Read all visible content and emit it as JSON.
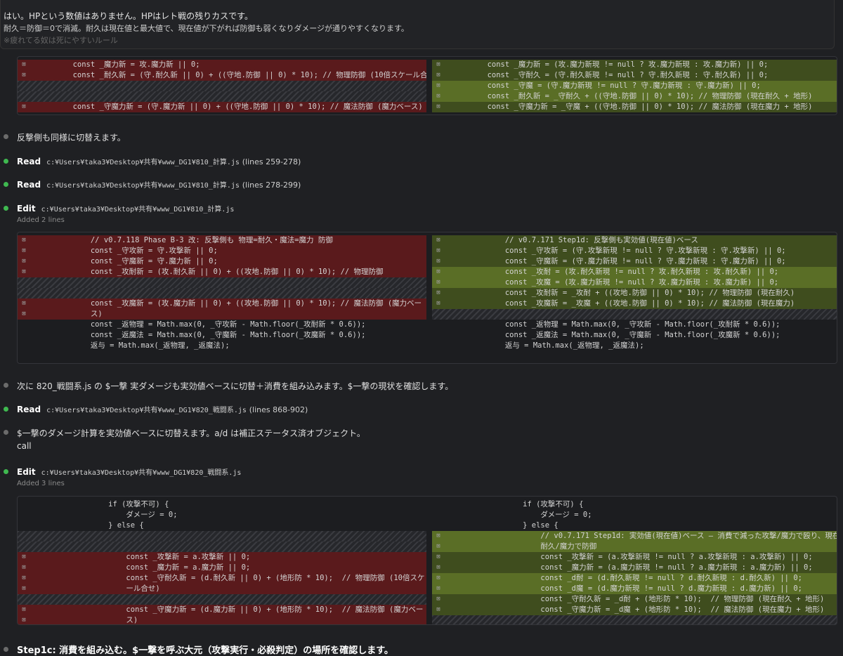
{
  "quote": {
    "line1": "はい。HPという数値はありません。HPはレト戦の残りカスです。",
    "line2": "耐久＝防御＝0で消滅。耐久は現在値と最大値で、現在値が下がれば防御も弱くなりダメージが通りやすくなります。",
    "line3": "※疲れてる奴は死にやすいルール"
  },
  "diff1": {
    "left": [
      {
        "g": "⊠",
        "t": "        const _魔力新 = 攻.魔力新 || 0;",
        "k": "del"
      },
      {
        "g": "⊠",
        "t": "        const _耐久新 = (守.耐久新 || 0) + ((守地.防御 || 0) * 10); // 物理防御 (10倍スケール合せ)",
        "k": "del"
      },
      {
        "g": "",
        "t": "",
        "k": "hatch"
      },
      {
        "g": "",
        "t": "",
        "k": "hatch"
      },
      {
        "g": "⊠",
        "t": "        const _守魔力新 = (守.魔力新 || 0) + ((守地.防御 || 0) * 10); // 魔法防御 (魔力ベース)",
        "k": "del"
      }
    ],
    "right": [
      {
        "g": "⊠",
        "t": "        const _魔力新 = (攻.魔力新現 != null ? 攻.魔力新現 : 攻.魔力新) || 0;",
        "k": "add"
      },
      {
        "g": "⊠",
        "t": "        const _守耐久 = (守.耐久新現 != null ? 守.耐久新現 : 守.耐久新) || 0;",
        "k": "add"
      },
      {
        "g": "⊠",
        "t": "        const _守魔 = (守.魔力新現 != null ? 守.魔力新現 : 守.魔力新) || 0;",
        "k": "addhi"
      },
      {
        "g": "⊠",
        "t": "        const _耐久新 = _守耐久 + ((守地.防御 || 0) * 10); // 物理防御 (現在耐久 + 地形)",
        "k": "addhi"
      },
      {
        "g": "⊠",
        "t": "        const _守魔力新 = _守魔 + ((守地.防御 || 0) * 10); // 魔法防御 (現在魔力 + 地形)",
        "k": "add"
      }
    ]
  },
  "items": {
    "m1": "反撃側も同様に切替えます。",
    "read1": {
      "label": "Read",
      "path": "c:¥Users¥taka3¥Desktop¥共有¥www_DG1¥810_計算.js",
      "range": "(lines 259-278)"
    },
    "read2": {
      "label": "Read",
      "path": "c:¥Users¥taka3¥Desktop¥共有¥www_DG1¥810_計算.js",
      "range": "(lines 278-299)"
    },
    "edit1": {
      "label": "Edit",
      "path": "c:¥Users¥taka3¥Desktop¥共有¥www_DG1¥810_計算.js",
      "sub": "Added 2 lines"
    },
    "m2": "次に 820_戦闘系.js の $一撃 実ダメージも実効値ベースに切替＋消費を組み込みます。$一撃の現状を確認します。",
    "read3": {
      "label": "Read",
      "path": "c:¥Users¥taka3¥Desktop¥共有¥www_DG1¥820_戦闘系.js",
      "range": "(lines 868-902)"
    },
    "m3": "$一撃のダメージ計算を実効値ベースに切替えます。a/d は補正ステータス済オブジェクト。",
    "m3b": "call",
    "edit2": {
      "label": "Edit",
      "path": "c:¥Users¥taka3¥Desktop¥共有¥www_DG1¥820_戦闘系.js",
      "sub": "Added 3 lines"
    },
    "m4": "Step1c: 消費を組み込む。$一撃を呼ぶ大元（攻撃実行・必殺判定）の場所を確認します。"
  },
  "diff2": {
    "left": [
      {
        "g": "⊠",
        "t": "            // v0.7.118 Phase B-3 改: 反撃側も 物理=耐久・魔法=魔力 防御",
        "k": "del"
      },
      {
        "g": "⊠",
        "t": "            const _守攻新 = 守.攻撃新 || 0;",
        "k": "del"
      },
      {
        "g": "⊠",
        "t": "            const _守魔新 = 守.魔力新 || 0;",
        "k": "del"
      },
      {
        "g": "⊠",
        "t": "            const _攻耐新 = (攻.耐久新 || 0) + ((攻地.防御 || 0) * 10); // 物理防御",
        "k": "del"
      },
      {
        "g": "",
        "t": "",
        "k": "hatch"
      },
      {
        "g": "",
        "t": "",
        "k": "hatch"
      },
      {
        "g": "⊠",
        "t": "            const _攻魔新 = (攻.魔力新 || 0) + ((攻地.防御 || 0) * 10); // 魔法防御 (魔力ベー",
        "k": "del"
      },
      {
        "g": "⊠",
        "t": "            ス)",
        "k": "del"
      },
      {
        "g": "",
        "t": "            const _返物理 = Math.max(0, _守攻新 - Math.floor(_攻耐新 * 0.6));",
        "k": ""
      },
      {
        "g": "",
        "t": "            const _返魔法 = Math.max(0, _守魔新 - Math.floor(_攻魔新 * 0.6));",
        "k": ""
      },
      {
        "g": "",
        "t": "            返与 = Math.max(_返物理, _返魔法);",
        "k": ""
      }
    ],
    "right": [
      {
        "g": "⊠",
        "t": "            // v0.7.171 Step1d: 反撃側も実効値(現在値)ベース",
        "k": "add"
      },
      {
        "g": "⊠",
        "t": "            const _守攻新 = (守.攻撃新現 != null ? 守.攻撃新現 : 守.攻撃新) || 0;",
        "k": "add"
      },
      {
        "g": "⊠",
        "t": "            const _守魔新 = (守.魔力新現 != null ? 守.魔力新現 : 守.魔力新) || 0;",
        "k": "add"
      },
      {
        "g": "⊠",
        "t": "            const _攻耐 = (攻.耐久新現 != null ? 攻.耐久新現 : 攻.耐久新) || 0;",
        "k": "addhi"
      },
      {
        "g": "⊠",
        "t": "            const _攻魔 = (攻.魔力新現 != null ? 攻.魔力新現 : 攻.魔力新) || 0;",
        "k": "addhi"
      },
      {
        "g": "⊠",
        "t": "            const _攻耐新 = _攻耐 + ((攻地.防御 || 0) * 10); // 物理防御 (現在耐久)",
        "k": "add"
      },
      {
        "g": "⊠",
        "t": "            const _攻魔新 = _攻魔 + ((攻地.防御 || 0) * 10); // 魔法防御 (現在魔力)",
        "k": "add"
      },
      {
        "g": "",
        "t": "",
        "k": "hatch"
      },
      {
        "g": "",
        "t": "            const _返物理 = Math.max(0, _守攻新 - Math.floor(_攻耐新 * 0.6));",
        "k": ""
      },
      {
        "g": "",
        "t": "            const _返魔法 = Math.max(0, _守魔新 - Math.floor(_攻魔新 * 0.6));",
        "k": ""
      },
      {
        "g": "",
        "t": "            返与 = Math.max(_返物理, _返魔法);",
        "k": ""
      }
    ]
  },
  "diff3": {
    "left": [
      {
        "g": "",
        "t": "                if (攻撃不可) {",
        "k": ""
      },
      {
        "g": "",
        "t": "                    ダメージ = 0;",
        "k": ""
      },
      {
        "g": "",
        "t": "                } else {",
        "k": ""
      },
      {
        "g": "",
        "t": "",
        "k": "hatch"
      },
      {
        "g": "",
        "t": "",
        "k": "hatch"
      },
      {
        "g": "⊠",
        "t": "                    const _攻撃新 = a.攻撃新 || 0;",
        "k": "del"
      },
      {
        "g": "⊠",
        "t": "                    const _魔力新 = a.魔力新 || 0;",
        "k": "del"
      },
      {
        "g": "⊠",
        "t": "                    const _守耐久新 = (d.耐久新 || 0) + (地形防 * 10);  // 物理防御 (10倍スケ",
        "k": "del"
      },
      {
        "g": "⊠",
        "t": "                    ール合せ)",
        "k": "del"
      },
      {
        "g": "",
        "t": "",
        "k": "hatch"
      },
      {
        "g": "⊠",
        "t": "                    const _守魔力新 = (d.魔力新 || 0) + (地形防 * 10);  // 魔法防御 (魔力ベー",
        "k": "del"
      },
      {
        "g": "⊠",
        "t": "                    ス)",
        "k": "del"
      }
    ],
    "right": [
      {
        "g": "",
        "t": "                if (攻撃不可) {",
        "k": ""
      },
      {
        "g": "",
        "t": "                    ダメージ = 0;",
        "k": ""
      },
      {
        "g": "",
        "t": "                } else {",
        "k": ""
      },
      {
        "g": "⊠",
        "t": "                    // v0.7.171 Step1d: 実効値(現在値)ベース — 消費で減った攻撃/魔力で殴り、現在",
        "k": "addhi"
      },
      {
        "g": "⊠",
        "t": "                    耐久/魔力で防御",
        "k": "addhi"
      },
      {
        "g": "⊠",
        "t": "                    const _攻撃新 = (a.攻撃新現 != null ? a.攻撃新現 : a.攻撃新) || 0;",
        "k": "add"
      },
      {
        "g": "⊠",
        "t": "                    const _魔力新 = (a.魔力新現 != null ? a.魔力新現 : a.魔力新) || 0;",
        "k": "add"
      },
      {
        "g": "⊠",
        "t": "                    const _d耐 = (d.耐久新現 != null ? d.耐久新現 : d.耐久新) || 0;",
        "k": "addhi"
      },
      {
        "g": "⊠",
        "t": "                    const _d魔 = (d.魔力新現 != null ? d.魔力新現 : d.魔力新) || 0;",
        "k": "addhi"
      },
      {
        "g": "⊠",
        "t": "                    const _守耐久新 = _d耐 + (地形防 * 10);  // 物理防御 (現在耐久 + 地形)",
        "k": "add"
      },
      {
        "g": "⊠",
        "t": "                    const _守魔力新 = _d魔 + (地形防 * 10);  // 魔法防御 (現在魔力 + 地形)",
        "k": "add"
      },
      {
        "g": "",
        "t": "",
        "k": "hatch"
      }
    ]
  }
}
